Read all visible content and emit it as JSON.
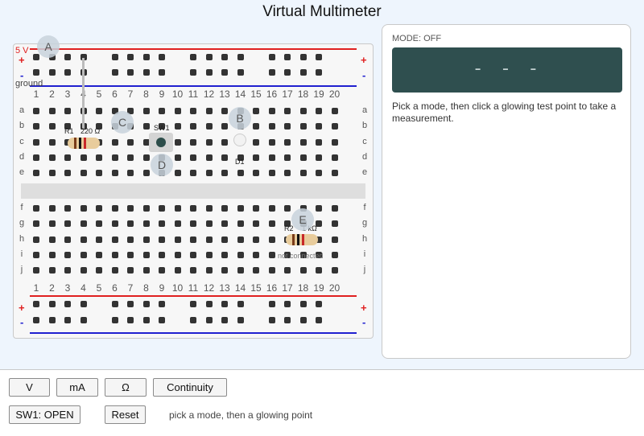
{
  "title": "Virtual Multimeter",
  "breadboard": {
    "rail_top_label": "5 V",
    "ground_label": "ground",
    "plus": "+",
    "minus": "-",
    "columns": [
      "1",
      "2",
      "3",
      "4",
      "5",
      "6",
      "7",
      "8",
      "9",
      "10",
      "11",
      "12",
      "13",
      "14",
      "15",
      "16",
      "17",
      "18",
      "19",
      "20"
    ],
    "rows_top": [
      "a",
      "b",
      "c",
      "d",
      "e"
    ],
    "rows_bottom": [
      "f",
      "g",
      "h",
      "i",
      "j"
    ],
    "components": {
      "r1_label": "R1",
      "r1_value": "220 Ω",
      "sw1_label": "SW1",
      "d1_label": "D1",
      "r2_label": "R2",
      "r2_value": "1 kΩ",
      "not_connected": "not connected"
    },
    "test_points": [
      "A",
      "B",
      "C",
      "D",
      "E"
    ]
  },
  "meter": {
    "mode": "MODE: OFF",
    "display": "- - -",
    "hint": "Pick a mode, then click a glowing test point to take a measurement."
  },
  "controls": {
    "modes": [
      "V",
      "mA",
      "Ω",
      "Continuity"
    ],
    "switch_label": "SW1: OPEN",
    "reset_label": "Reset",
    "status": "pick a mode, then a glowing point"
  },
  "colors": {
    "rail_positive": "#e02020",
    "rail_negative": "#2020d0",
    "display_bg": "#2f4f4f",
    "resistor_body": "#e8cc9c"
  }
}
